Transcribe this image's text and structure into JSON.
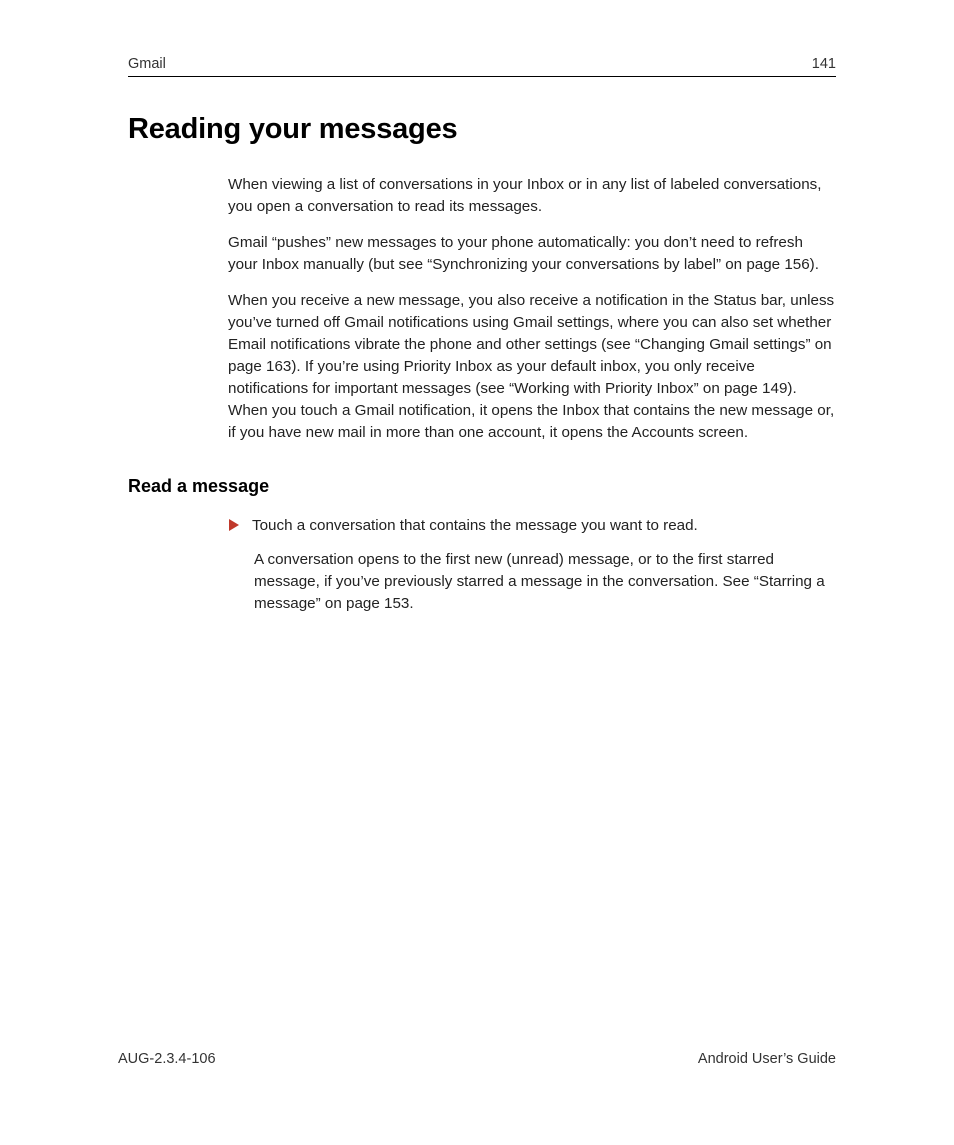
{
  "header": {
    "section": "Gmail",
    "page_number": "141"
  },
  "title": "Reading your messages",
  "paragraphs": {
    "p1": "When viewing a list of conversations in your Inbox or in any list of labeled conversations, you open a conversation to read its messages.",
    "p2": "Gmail “pushes” new messages to your phone automatically: you don’t need to refresh your Inbox manually (but see “Synchronizing your conversations by label” on page 156).",
    "p3": "When you receive a new message, you also receive a notification in the Status bar, unless you’ve turned off Gmail notifications using Gmail settings, where you can also set whether Email notifications vibrate the phone and other settings (see “Changing Gmail settings” on page 163). If you’re using Priority Inbox as your default inbox, you only receive notifications for important messages (see “Working with Priority Inbox” on page 149). When you touch a Gmail notification, it opens the Inbox that contains the new message or, if you have new mail in more than one account, it opens the Accounts screen."
  },
  "subhead": "Read a message",
  "bullet": {
    "text": "Touch a conversation that contains the message you want to read."
  },
  "follow": "A conversation opens to the first new (unread) message, or to the first starred message, if you’ve previously starred a message in the conversation. See “Starring a message” on page 153.",
  "footer": {
    "doc_id": "AUG-2.3.4-106",
    "guide": "Android User’s Guide"
  }
}
